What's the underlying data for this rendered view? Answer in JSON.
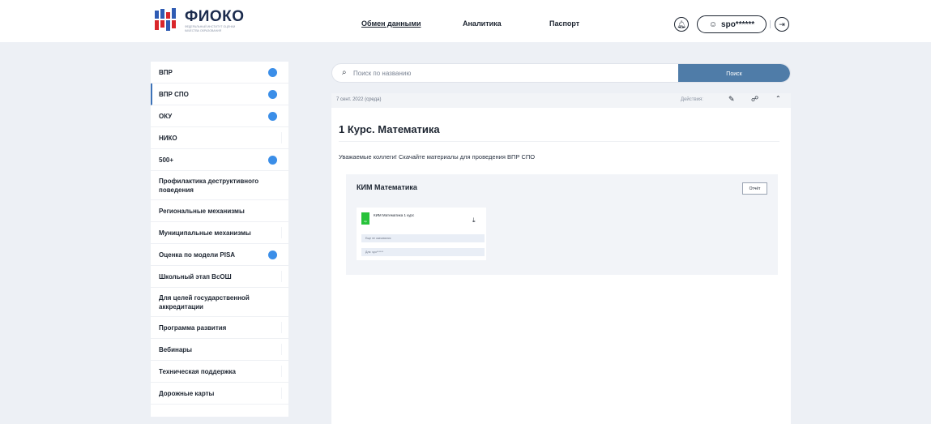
{
  "header": {
    "logo_text": "ФИОКО",
    "logo_subtitle": "ФЕДЕРАЛЬНЫЙ ИНСТИТУТ ОЦЕНКИ КАЧЕСТВА ОБРАЗОВАНИЯ",
    "nav": [
      {
        "label": "Обмен данными",
        "active": true
      },
      {
        "label": "Аналитика",
        "active": false
      },
      {
        "label": "Паспорт",
        "active": false
      }
    ],
    "user_label": "spo******",
    "icons": {
      "bell": "bell-icon",
      "user": "user-icon",
      "logout": "logout-icon"
    }
  },
  "sidebar": {
    "items": [
      {
        "label": "ВПР",
        "dot": true
      },
      {
        "label": "ВПР СПО",
        "dot": true,
        "active": true
      },
      {
        "label": "ОКУ",
        "dot": true
      },
      {
        "label": "НИКО",
        "dot": false
      },
      {
        "label": "500+",
        "dot": true
      },
      {
        "label": "Профилактика деструктивного поведения",
        "dot": false
      },
      {
        "label": "Региональные механизмы",
        "dot": false
      },
      {
        "label": "Муниципальные механизмы",
        "dot": false
      },
      {
        "label": "Оценка по модели PISA",
        "dot": true
      },
      {
        "label": "Школьный этап ВсОШ",
        "dot": false
      },
      {
        "label": "Для целей государственной аккредитации",
        "dot": false
      },
      {
        "label": "Программа развития",
        "dot": false
      },
      {
        "label": "Вебинары",
        "dot": false
      },
      {
        "label": "Техническая поддержка",
        "dot": false
      },
      {
        "label": "Дорожные карты",
        "dot": false
      }
    ],
    "dot_color": "#3b8ee8"
  },
  "search": {
    "placeholder": "Поиск по названию",
    "button_label": "Поиск",
    "button_color": "#4f7ca8"
  },
  "post": {
    "date": "7 сент. 2022 (среда)",
    "actions_label": "Действия:",
    "title": "1 Курс. Математика",
    "text": "Уважаемые коллеги! Скачайте материалы для проведения ВПР СПО",
    "block": {
      "title": "КИМ Математика",
      "report_label": "Отчёт",
      "file": {
        "badge": "zip",
        "name": "КИМ Математика 1 курс",
        "status": "Еще не скачивался",
        "for_label": "Для: spo******"
      }
    }
  }
}
